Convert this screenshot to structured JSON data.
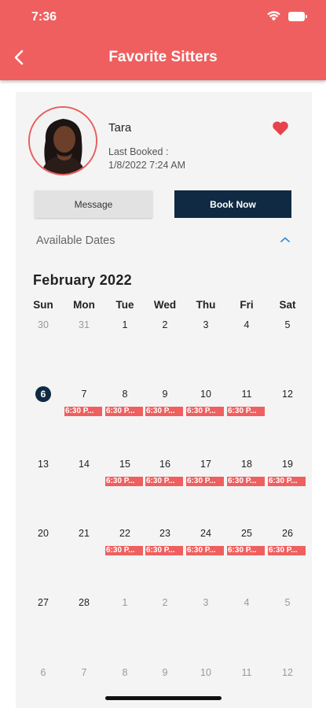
{
  "status": {
    "time": "7:36"
  },
  "header": {
    "title": "Favorite Sitters"
  },
  "sitter": {
    "name": "Tara",
    "last_booked_label": "Last Booked :",
    "last_booked_date": "1/8/2022 7:24 AM"
  },
  "buttons": {
    "message": "Message",
    "book_now": "Book Now"
  },
  "available_dates_label": "Available Dates",
  "calendar": {
    "month": "February 2022",
    "weekdays": [
      "Sun",
      "Mon",
      "Tue",
      "Wed",
      "Thu",
      "Fri",
      "Sat"
    ],
    "weeks": [
      [
        {
          "day": "30",
          "muted": true
        },
        {
          "day": "31",
          "muted": true
        },
        {
          "day": "1"
        },
        {
          "day": "2"
        },
        {
          "day": "3"
        },
        {
          "day": "4"
        },
        {
          "day": "5"
        }
      ],
      [
        {
          "day": "6",
          "today": true
        },
        {
          "day": "7",
          "event": "6:30 P..."
        },
        {
          "day": "8",
          "event": "6:30 P..."
        },
        {
          "day": "9",
          "event": "6:30 P..."
        },
        {
          "day": "10",
          "event": "6:30 P..."
        },
        {
          "day": "11",
          "event": "6:30 P..."
        },
        {
          "day": "12"
        }
      ],
      [
        {
          "day": "13"
        },
        {
          "day": "14"
        },
        {
          "day": "15",
          "event": "6:30 P..."
        },
        {
          "day": "16",
          "event": "6:30 P..."
        },
        {
          "day": "17",
          "event": "6:30 P..."
        },
        {
          "day": "18",
          "event": "6:30 P..."
        },
        {
          "day": "19",
          "event": "6:30 P..."
        }
      ],
      [
        {
          "day": "20"
        },
        {
          "day": "21"
        },
        {
          "day": "22",
          "event": "6:30 P..."
        },
        {
          "day": "23",
          "event": "6:30 P..."
        },
        {
          "day": "24",
          "event": "6:30 P..."
        },
        {
          "day": "25",
          "event": "6:30 P..."
        },
        {
          "day": "26",
          "event": "6:30 P..."
        }
      ],
      [
        {
          "day": "27"
        },
        {
          "day": "28"
        },
        {
          "day": "1",
          "muted": true
        },
        {
          "day": "2",
          "muted": true
        },
        {
          "day": "3",
          "muted": true
        },
        {
          "day": "4",
          "muted": true
        },
        {
          "day": "5",
          "muted": true
        }
      ],
      [
        {
          "day": "6",
          "muted": true
        },
        {
          "day": "7",
          "muted": true
        },
        {
          "day": "8",
          "muted": true
        },
        {
          "day": "9",
          "muted": true
        },
        {
          "day": "10",
          "muted": true
        },
        {
          "day": "11",
          "muted": true
        },
        {
          "day": "12",
          "muted": true
        }
      ]
    ]
  },
  "colors": {
    "header": "#ef5f5f",
    "accent_dark": "#0f2a42",
    "event": "#ef5f5f",
    "heart": "#e8424b"
  },
  "icons": {
    "back": "back-arrow-icon",
    "favorite": "heart-icon",
    "collapse": "chevron-up-icon",
    "wifi": "wifi-icon",
    "battery": "battery-icon"
  }
}
